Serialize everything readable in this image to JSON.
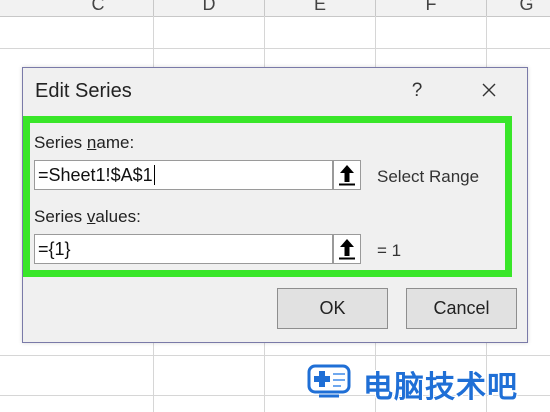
{
  "spreadsheet": {
    "columns": [
      "C",
      "D",
      "E",
      "F",
      "G"
    ]
  },
  "dialog": {
    "title": "Edit Series",
    "help_label": "?",
    "series_name": {
      "label_prefix": "Series ",
      "label_accel": "n",
      "label_suffix": "ame:",
      "value": "=Sheet1!$A$1",
      "result_text": "Select Range"
    },
    "series_values": {
      "label_prefix": "Series ",
      "label_accel": "v",
      "label_suffix": "alues:",
      "value": "={1}",
      "result_text": "= 1"
    },
    "ok_label": "OK",
    "cancel_label": "Cancel"
  },
  "watermark": {
    "text": "电脑技术吧"
  },
  "colors": {
    "highlight": "#39e629",
    "watermark": "#1f6fd6"
  }
}
